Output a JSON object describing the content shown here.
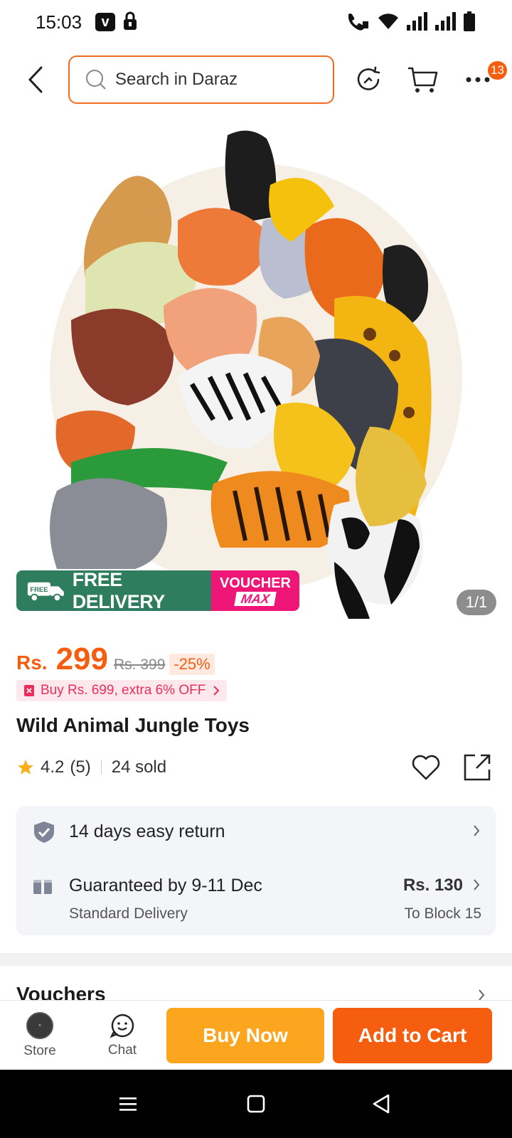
{
  "status_bar": {
    "time": "15:03",
    "left_icons": [
      "v-app-icon",
      "lock-icon"
    ],
    "right_icons": [
      "wifi-call-icon",
      "wifi-icon",
      "signal-icon",
      "signal-icon",
      "battery-icon"
    ]
  },
  "header": {
    "search_placeholder": "Search in Daraz",
    "cart_badge": "13",
    "icons": [
      "back-icon",
      "search-icon",
      "history-icon",
      "cart-icon",
      "more-icon"
    ]
  },
  "gallery": {
    "page_indicator": "1/1",
    "promo_free_delivery": "FREE DELIVERY",
    "promo_voucher_line1": "VOUCHER",
    "promo_voucher_line2": "MAX",
    "truck_badge_text": "FREE"
  },
  "price": {
    "currency": "Rs.",
    "value": "299",
    "original": "Rs. 399",
    "discount": "-25%",
    "promo": "Buy Rs. 699, extra 6% OFF"
  },
  "product": {
    "title": "Wild Animal Jungle Toys",
    "rating": "4.2",
    "rating_count": "(5)",
    "sold": "24 sold"
  },
  "service": {
    "return_text": "14 days easy return",
    "delivery_text": "Guaranteed by 9-11 Dec",
    "delivery_sub": "Standard Delivery",
    "delivery_price": "Rs. 130",
    "delivery_dest": "To Block 15"
  },
  "vouchers": {
    "title": "Vouchers"
  },
  "bottom_bar": {
    "store_label": "Store",
    "chat_label": "Chat",
    "buy_now": "Buy Now",
    "add_to_cart": "Add to Cart"
  },
  "colors": {
    "accent": "#f55d0f",
    "buy_now": "#fba61e",
    "free_delivery": "#2e7d5e",
    "voucher": "#ee1778"
  }
}
